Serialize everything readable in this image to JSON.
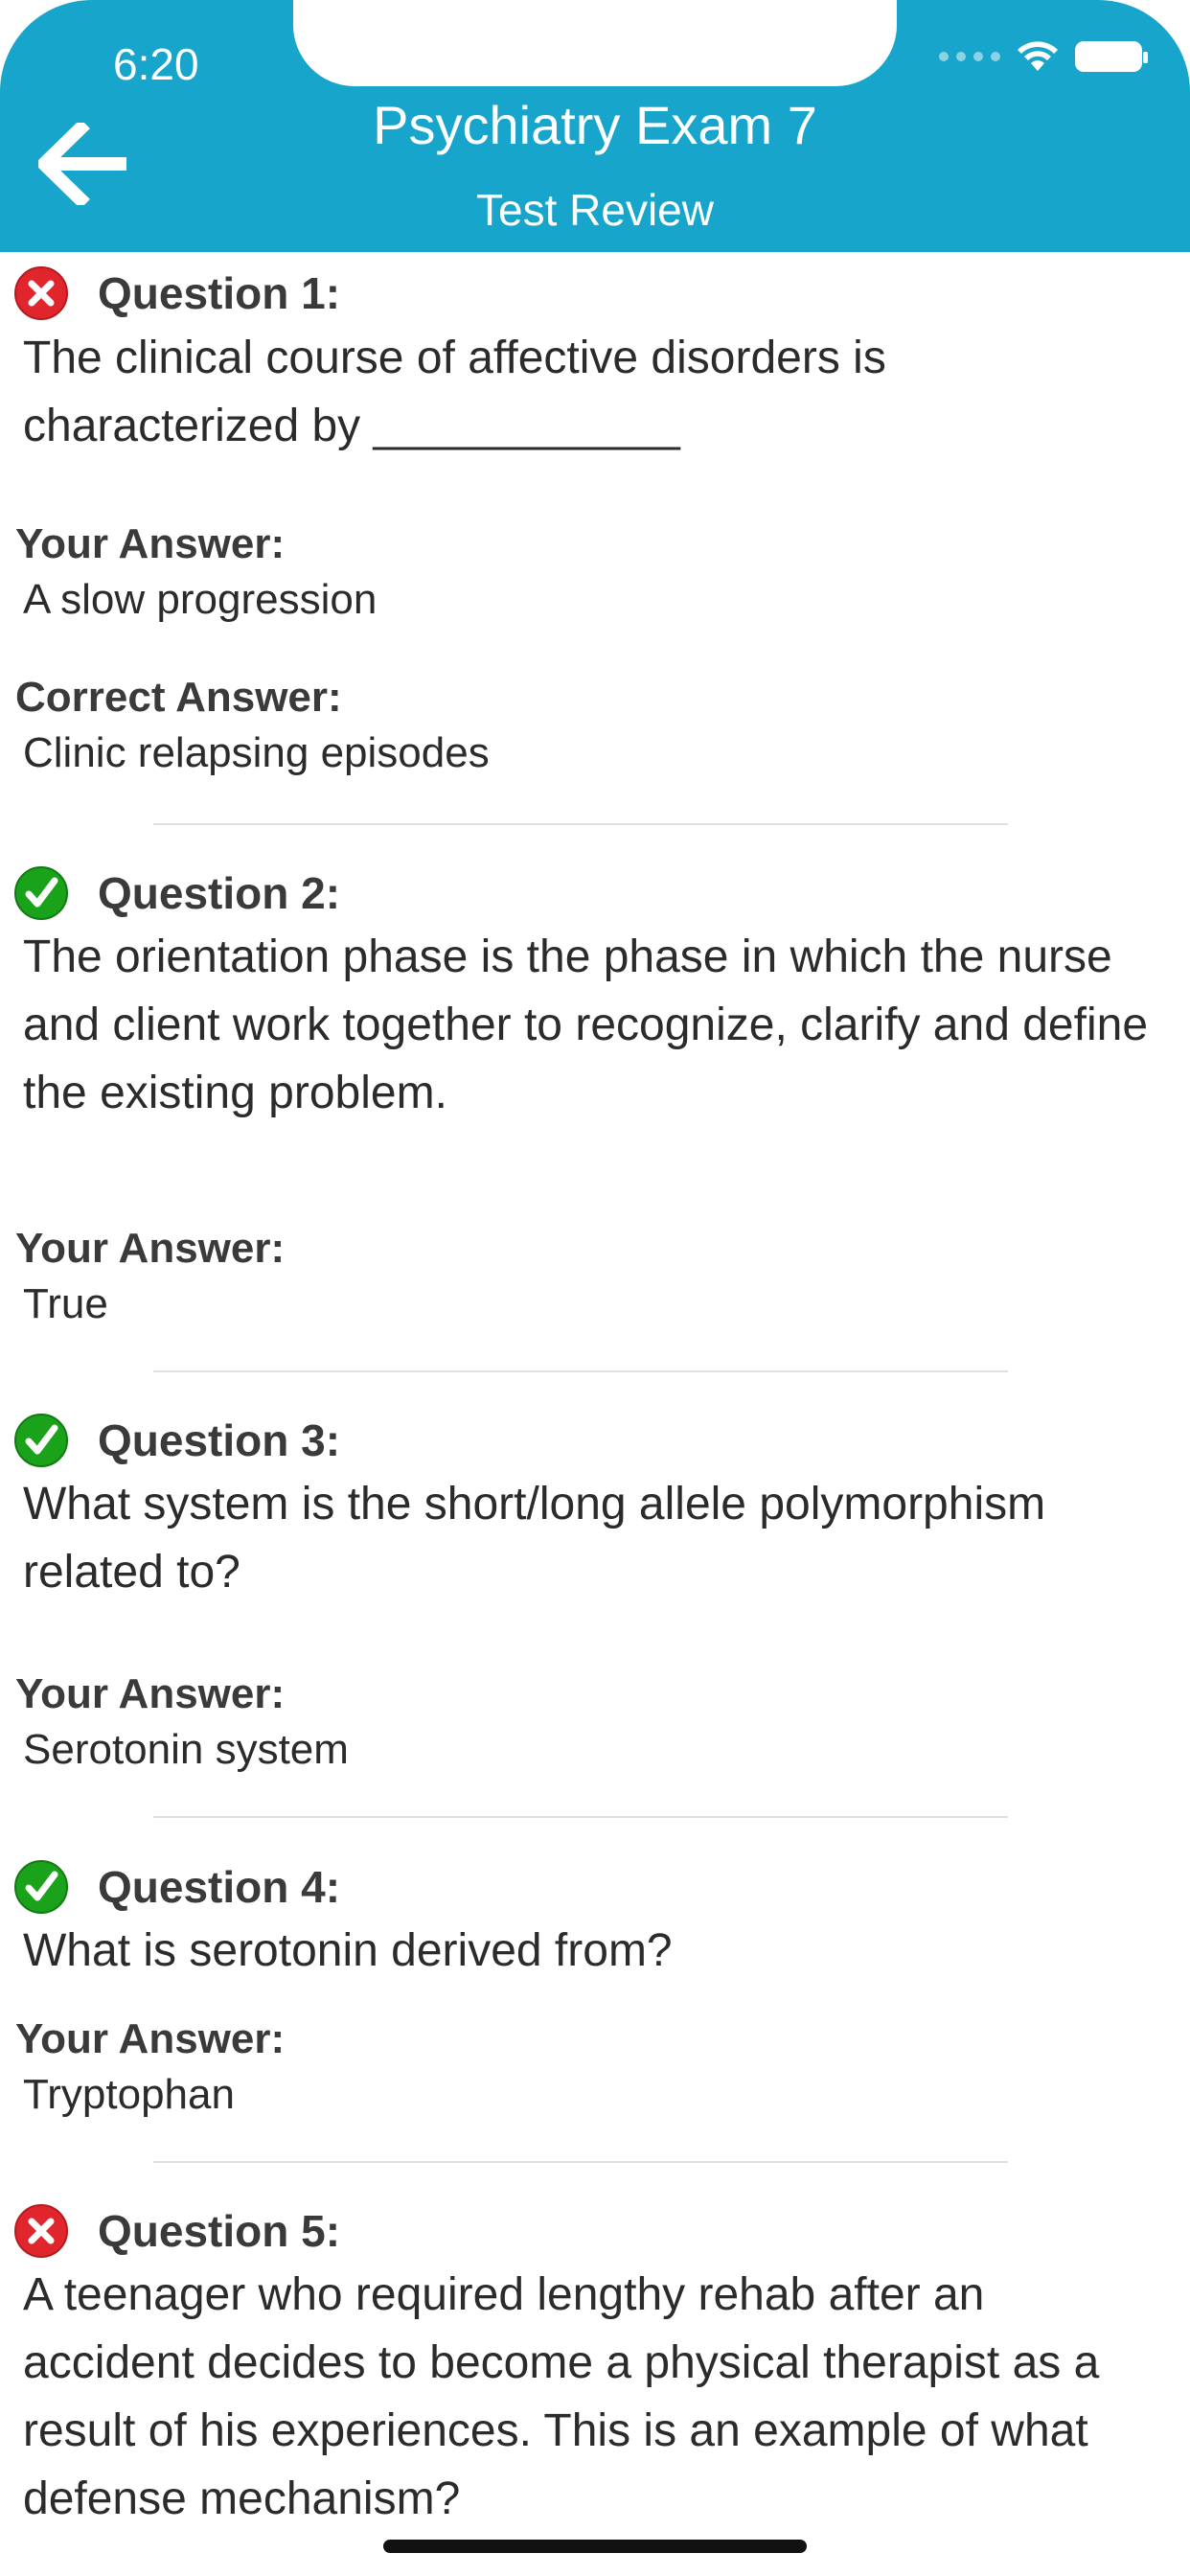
{
  "status_bar": {
    "time": "6:20"
  },
  "header": {
    "title": "Psychiatry Exam 7",
    "subtitle": "Test Review"
  },
  "colors": {
    "header_bg": "#17a5cc",
    "correct": "#1aa31a",
    "incorrect": "#e0262c"
  },
  "questions": [
    {
      "label": "Question 1:",
      "status": "incorrect",
      "icon": "x-circle-icon",
      "text": "The clinical course of affective disorders is characterized by ____________",
      "your_answer_label": "Your Answer:",
      "your_answer": "A slow progression",
      "correct_answer_label": "Correct Answer:",
      "correct_answer": "Clinic relapsing episodes"
    },
    {
      "label": "Question 2:",
      "status": "correct",
      "icon": "check-circle-icon",
      "text": "The orientation phase is the phase in which the nurse and client work together to recognize, clarify and define the existing problem.",
      "your_answer_label": "Your Answer:",
      "your_answer": "True"
    },
    {
      "label": "Question 3:",
      "status": "correct",
      "icon": "check-circle-icon",
      "text": "What system is the short/long allele polymorphism related to?",
      "your_answer_label": "Your Answer:",
      "your_answer": "Serotonin system"
    },
    {
      "label": "Question 4:",
      "status": "correct",
      "icon": "check-circle-icon",
      "text": "What is serotonin derived from?",
      "your_answer_label": "Your Answer:",
      "your_answer": "Tryptophan"
    },
    {
      "label": "Question 5:",
      "status": "incorrect",
      "icon": "x-circle-icon",
      "text": "A teenager who required lengthy rehab after an accident decides to become a physical therapist as a result of his experiences. This is an example of what defense mechanism?"
    }
  ]
}
